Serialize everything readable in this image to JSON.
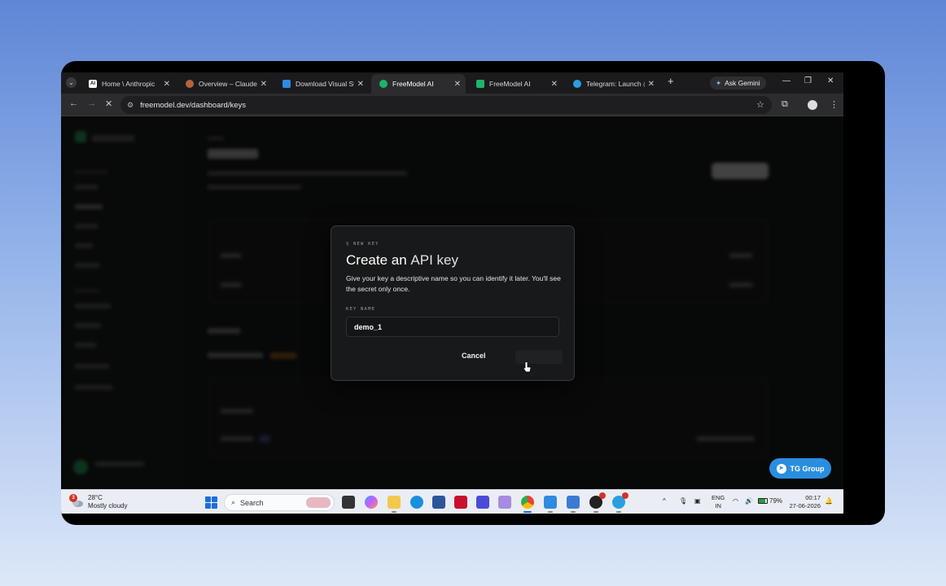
{
  "browser": {
    "tabs": [
      {
        "label": "Home \\ Anthropic",
        "favicon": "AI",
        "favicon_color": "#ffffff",
        "active": false
      },
      {
        "label": "Overview – Claude Code",
        "favicon": "",
        "favicon_color": "#b4633e",
        "active": false
      },
      {
        "label": "Download Visual Studio",
        "favicon": "",
        "favicon_color": "#2f8ae0",
        "active": false
      },
      {
        "label": "FreeModel AI",
        "favicon": "",
        "favicon_color": "#1fb36a",
        "active": true
      },
      {
        "label": "FreeModel AI",
        "favicon": "",
        "favicon_color": "#1fb36a",
        "active": false
      },
      {
        "label": "Telegram: Launch @FreeModel",
        "favicon": "",
        "favicon_color": "#2a9fe0",
        "active": false
      }
    ],
    "gemini_label": "Ask Gemini",
    "url": "freemodel.dev/dashboard/keys"
  },
  "modal": {
    "eyebrow": "§ NEW KEY",
    "title_prefix": "Create an",
    "title_accent": "API key",
    "description": "Give your key a descriptive name so you can identify it later. You'll see the secret only once.",
    "field_label": "KEY NAME",
    "field_value": "demo_1",
    "cancel_label": "Cancel"
  },
  "floating": {
    "tg_label": "TG Group"
  },
  "taskbar": {
    "weather_temp": "28°C",
    "weather_desc": "Mostly cloudy",
    "weather_badge": "3",
    "search_placeholder": "Search",
    "lang_line1": "ENG",
    "lang_line2": "IN",
    "battery": "79%",
    "time": "00:17",
    "date": "27-06-2026"
  },
  "colors": {
    "accent_green": "#1aa35a",
    "tg_blue": "#2a8ee0"
  }
}
